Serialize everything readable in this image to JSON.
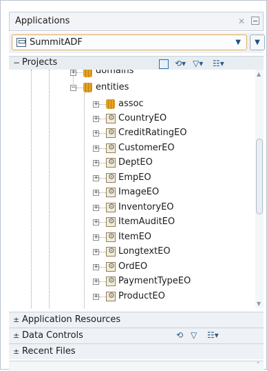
{
  "panel": {
    "title": "Applications",
    "app_selector": {
      "selected": "SummitADF"
    }
  },
  "projects": {
    "label": "Projects",
    "tree": {
      "clipped_top": "domains",
      "folder": "entities",
      "subfolder": "assoc",
      "items": [
        "CountryEO",
        "CreditRatingEO",
        "CustomerEO",
        "DeptEO",
        "EmpEO",
        "ImageEO",
        "InventoryEO",
        "ItemAuditEO",
        "ItemEO",
        "LongtextEO",
        "OrdEO",
        "PaymentTypeEO"
      ],
      "clipped_bottom": "ProductEO"
    }
  },
  "sections": {
    "app_resources": "Application Resources",
    "data_controls": "Data Controls",
    "recent_files": "Recent Files"
  },
  "icons": {
    "expand": "plus-box-icon",
    "collapse": "minus-box-icon",
    "package": "package-icon",
    "entity": "entity-object-icon"
  },
  "colors": {
    "accent_border": "#e8a94f",
    "link_blue": "#2b5b8c"
  }
}
